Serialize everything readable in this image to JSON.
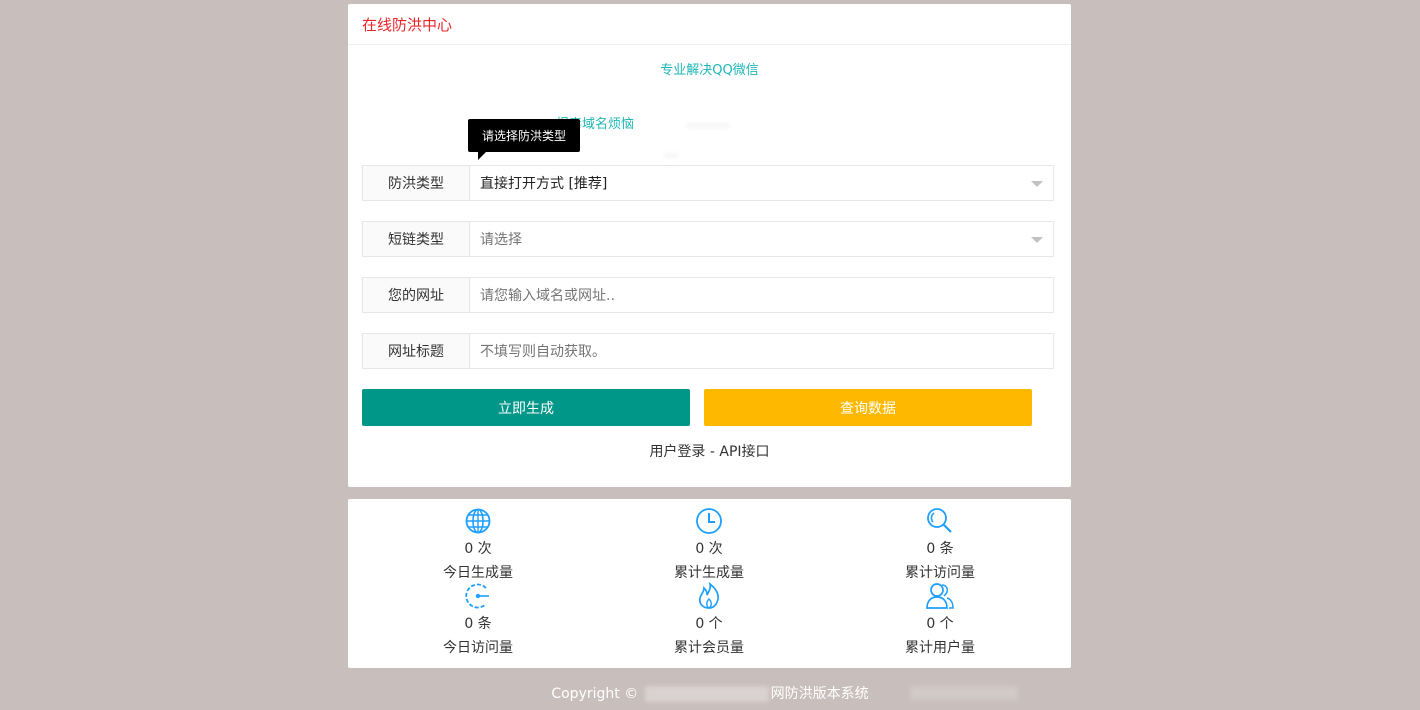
{
  "header": {
    "title": "在线防洪中心"
  },
  "slogans": {
    "line1": "专业解决QQ微信",
    "line2": "报毒域名烦恼"
  },
  "tooltip": {
    "text": "请选择防洪类型"
  },
  "form": {
    "protect_type": {
      "label": "防洪类型",
      "value": "直接打开方式 [推荐]"
    },
    "short_type": {
      "label": "短链类型",
      "placeholder": "请选择"
    },
    "url": {
      "label": "您的网址",
      "placeholder": "请您输入域名或网址.."
    },
    "title": {
      "label": "网址标题",
      "placeholder": "不填写则自动获取。"
    }
  },
  "buttons": {
    "generate": "立即生成",
    "query": "查询数据"
  },
  "links": {
    "text": "用户登录 - API接口"
  },
  "stats": [
    {
      "icon": "globe-icon",
      "value": "0 次",
      "label": "今日生成量"
    },
    {
      "icon": "clock-icon",
      "value": "0 次",
      "label": "累计生成量"
    },
    {
      "icon": "search-icon",
      "value": "0 条",
      "label": "累计访问量"
    },
    {
      "icon": "gauge-icon",
      "value": "0 条",
      "label": "今日访问量"
    },
    {
      "icon": "flame-icon",
      "value": "0 个",
      "label": "累计会员量"
    },
    {
      "icon": "users-icon",
      "value": "0 个",
      "label": "累计用户量"
    }
  ],
  "footer": {
    "copyright": "Copyright ©",
    "system": "网防洪版本系统"
  },
  "colors": {
    "accent_teal": "#009688",
    "accent_yellow": "#ffb800",
    "header_red": "#e8262a",
    "icon_blue": "#1e9fff",
    "background": "#c8bebb"
  }
}
